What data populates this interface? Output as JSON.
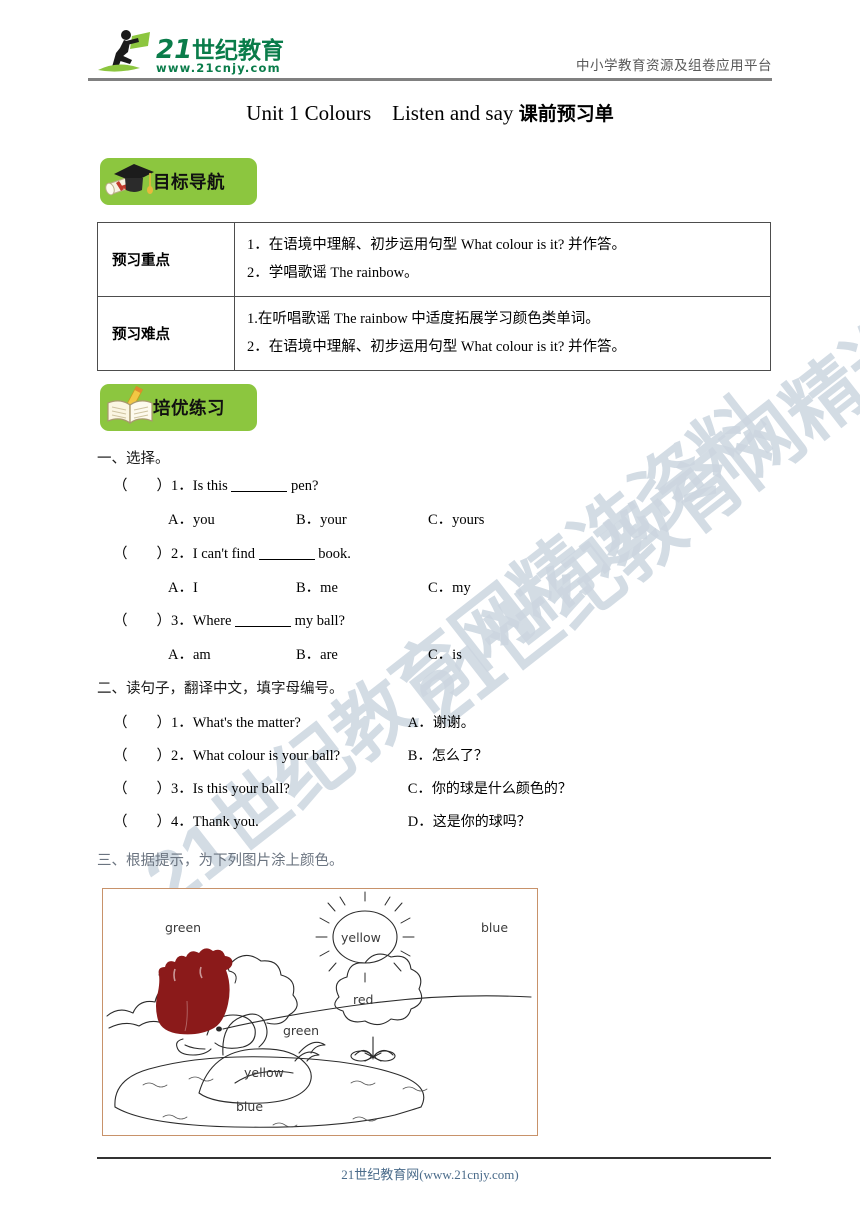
{
  "header": {
    "logo_brand": "21",
    "logo_cn": "世纪教育",
    "logo_url": "www.21cnjy.com",
    "subtitle": "中小学教育资源及组卷应用平台"
  },
  "title": {
    "english": "Unit 1 Colours Listen and say",
    "chinese": "课前预习单"
  },
  "badges": {
    "goal": {
      "label": "目标导航",
      "icon": "graduation-cap-icon",
      "color": "#8CC63F"
    },
    "practice": {
      "label": "培优练习",
      "icon": "open-book-pencil-icon",
      "color": "#8CC63F"
    }
  },
  "table": {
    "rows": [
      {
        "label": "预习重点",
        "lines": [
          "1．在语境中理解、初步运用句型 What colour is it?  并作答。",
          "2．学唱歌谣 The rainbow。"
        ]
      },
      {
        "label": "预习难点",
        "lines": [
          "1.在听唱歌谣 The rainbow 中适度拓展学习颜色类单词。",
          "2．在语境中理解、初步运用句型 What colour is it?  并作答。"
        ]
      }
    ]
  },
  "exercise1": {
    "heading": "一、选择。",
    "questions": [
      {
        "paren": "（　　）",
        "num": "1．",
        "stem_before": "Is this ",
        "stem_after": " pen?",
        "options": [
          {
            "letter": "A．",
            "text": "you"
          },
          {
            "letter": "B．",
            "text": "your"
          },
          {
            "letter": "C．",
            "text": "yours"
          }
        ]
      },
      {
        "paren": "（　　）",
        "num": "2．",
        "stem_before": "I can't find ",
        "stem_after": " book.",
        "options": [
          {
            "letter": "A．",
            "text": "I"
          },
          {
            "letter": "B．",
            "text": "me"
          },
          {
            "letter": "C．",
            "text": "my"
          }
        ]
      },
      {
        "paren": "（　　）",
        "num": "3．",
        "stem_before": "Where ",
        "stem_after": " my ball?",
        "options": [
          {
            "letter": "A．",
            "text": "am"
          },
          {
            "letter": "B．",
            "text": "are"
          },
          {
            "letter": "C．",
            "text": "is"
          }
        ]
      }
    ]
  },
  "exercise2": {
    "heading": "二、读句子，翻译中文，填字母编号。",
    "items": [
      {
        "paren": "（　　）",
        "num": "1．",
        "english": "What's the matter?",
        "letter": "A．",
        "chinese": "谢谢。"
      },
      {
        "paren": "（　　）",
        "num": "2．",
        "english": "What colour is your ball?",
        "letter": "B．",
        "chinese": "怎么了？"
      },
      {
        "paren": "（　　）",
        "num": "3．",
        "english": "Is this your ball?",
        "letter": "C．",
        "chinese": "你的球是什么颜色的？"
      },
      {
        "paren": "（　　）",
        "num": "4．",
        "english": "Thank you.",
        "letter": "D．",
        "chinese": "这是你的球吗？"
      }
    ]
  },
  "exercise3": {
    "heading": "三、根据提示，为下列图片涂上颜色。",
    "picture": {
      "name": "colouring-scene",
      "border_color": "#c8926a",
      "labels": [
        {
          "id": "grass-left",
          "text": "green"
        },
        {
          "id": "sun",
          "text": "yellow"
        },
        {
          "id": "sky",
          "text": "blue"
        },
        {
          "id": "bush",
          "text": "red"
        },
        {
          "id": "grass-mid",
          "text": "green"
        },
        {
          "id": "duck",
          "text": "yellow"
        },
        {
          "id": "pond",
          "text": "blue"
        }
      ],
      "coloured_shape": {
        "id": "tree",
        "fill": "#8B1A1A"
      }
    }
  },
  "watermark": {
    "text": "21世纪教育网精选资料",
    "color": "#ccd6e0"
  },
  "footer": {
    "text": "21世纪教育网(www.21cnjy.com)",
    "color": "#4a6b8a"
  }
}
